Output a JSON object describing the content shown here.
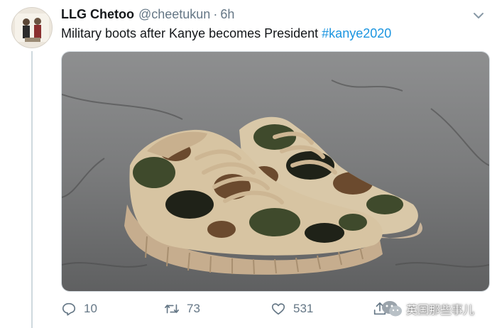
{
  "tweet": {
    "display_name": "LLG Chetoo",
    "handle": "@cheetukun",
    "separator": "·",
    "time": "6h",
    "text_main": "Military boots after Kanye becomes President ",
    "hashtag": "#kanye2020"
  },
  "media": {
    "subject": "camouflage-knit-sneakers"
  },
  "actions": {
    "reply_count": "10",
    "retweet_count": "73",
    "like_count": "531"
  },
  "watermark": {
    "text": "英国那些事儿"
  },
  "colors": {
    "text": "#14171a",
    "muted": "#657786",
    "link": "#1b95e0",
    "border": "#cfd9de"
  }
}
